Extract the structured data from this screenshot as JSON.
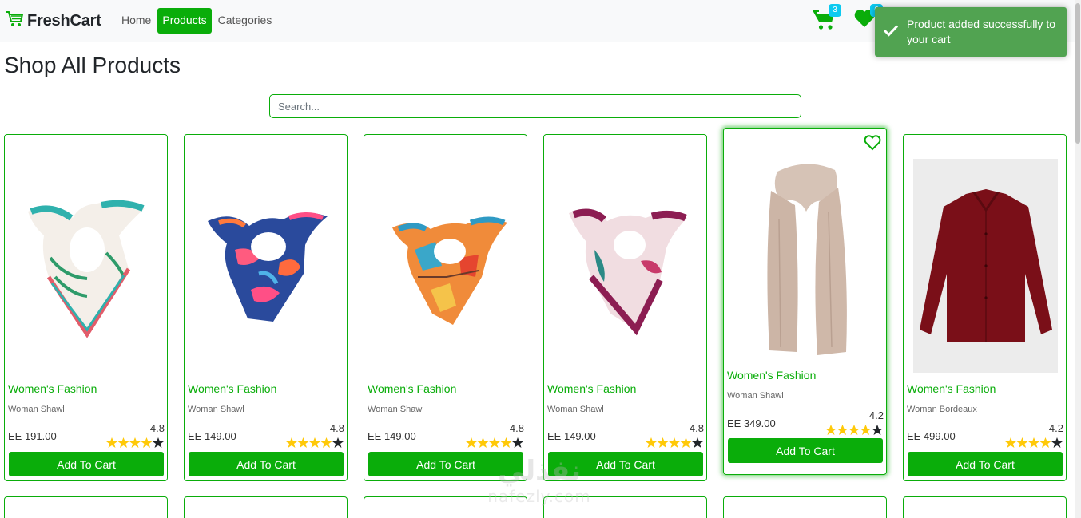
{
  "nav": {
    "brand": "FreshCart",
    "links": [
      "Home",
      "Products",
      "Categories"
    ],
    "cart_count": "3",
    "wishlist_count": "6"
  },
  "toast": {
    "message": "Product added successfully to your cart"
  },
  "page": {
    "title": "Shop All Products",
    "search_placeholder": "Search..."
  },
  "products": [
    {
      "category": "Women's Fashion",
      "name": "Woman Shawl",
      "price": "EE 191.00",
      "rating": "4.8",
      "button": "Add To Cart"
    },
    {
      "category": "Women's Fashion",
      "name": "Woman Shawl",
      "price": "EE 149.00",
      "rating": "4.8",
      "button": "Add To Cart"
    },
    {
      "category": "Women's Fashion",
      "name": "Woman Shawl",
      "price": "EE 149.00",
      "rating": "4.8",
      "button": "Add To Cart"
    },
    {
      "category": "Women's Fashion",
      "name": "Woman Shawl",
      "price": "EE 149.00",
      "rating": "4.8",
      "button": "Add To Cart"
    },
    {
      "category": "Women's Fashion",
      "name": "Woman Shawl",
      "price": "EE 349.00",
      "rating": "4.2",
      "button": "Add To Cart"
    },
    {
      "category": "Women's Fashion",
      "name": "Woman Bordeaux",
      "price": "EE 499.00",
      "rating": "4.2",
      "button": "Add To Cart"
    }
  ],
  "watermark": {
    "arabic": "نفذلي",
    "latin": "nafezly.com"
  },
  "colors": {
    "brand": "#0aad0a",
    "toast": "#51a351",
    "badge": "#0dcaf0",
    "star": "#ffc908"
  }
}
